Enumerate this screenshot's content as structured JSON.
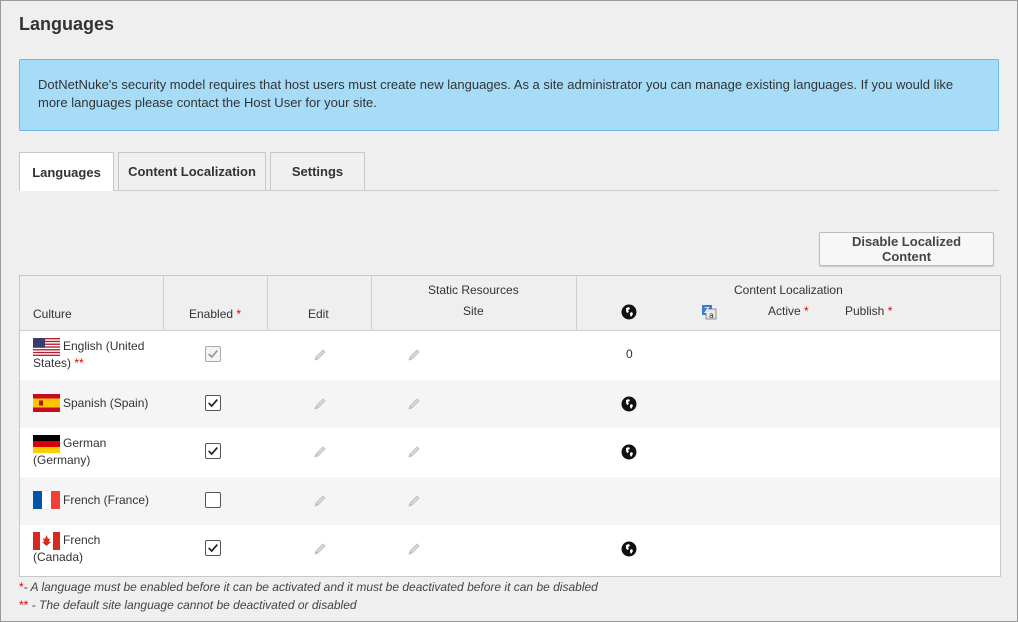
{
  "page": {
    "title": "Languages"
  },
  "info": {
    "text": "DotNetNuke's security model requires that host users must create new languages. As a site administrator you can manage existing languages. If you would like more languages please contact the Host User for your site."
  },
  "tabs": [
    {
      "label": "Languages",
      "active": true
    },
    {
      "label": "Content Localization",
      "active": false
    },
    {
      "label": "Settings",
      "active": false
    }
  ],
  "actions": {
    "disable_localized": "Disable Localized Content"
  },
  "grid": {
    "headers": {
      "culture": "Culture",
      "enabled": "Enabled",
      "edit": "Edit",
      "static_resources": "Static Resources",
      "site": "Site",
      "content_localization": "Content Localization",
      "active": "Active",
      "publish": "Publish",
      "required_mark": "*",
      "default_mark": "**"
    },
    "rows": [
      {
        "culture_line1": "English (United",
        "culture_line2": "States)",
        "is_default": true,
        "flag": "us-flag-icon",
        "enabled": true,
        "enabled_disabled": true,
        "content_value": "0"
      },
      {
        "culture_line1": "Spanish (Spain)",
        "culture_line2": "",
        "is_default": false,
        "flag": "es-flag-icon",
        "enabled": true,
        "enabled_disabled": false,
        "content_value": ""
      },
      {
        "culture_line1": "German",
        "culture_line2": "(Germany)",
        "is_default": false,
        "flag": "de-flag-icon",
        "enabled": true,
        "enabled_disabled": false,
        "content_value": ""
      },
      {
        "culture_line1": "French (France)",
        "culture_line2": "",
        "is_default": false,
        "flag": "fr-flag-icon",
        "enabled": false,
        "enabled_disabled": false,
        "content_value": ""
      },
      {
        "culture_line1": "French",
        "culture_line2": "(Canada)",
        "is_default": false,
        "flag": "ca-flag-icon",
        "enabled": true,
        "enabled_disabled": false,
        "content_value": ""
      }
    ]
  },
  "notes": {
    "note1_mark": "*",
    "note1": "- A language must be enabled before it can be activated and it must be deactivated before it can be disabled",
    "note2_mark": "**",
    "note2": " - The default site language cannot be deactivated or disabled"
  },
  "colors": {
    "info_bg": "#a7dcf9",
    "required": "#dd0000"
  }
}
